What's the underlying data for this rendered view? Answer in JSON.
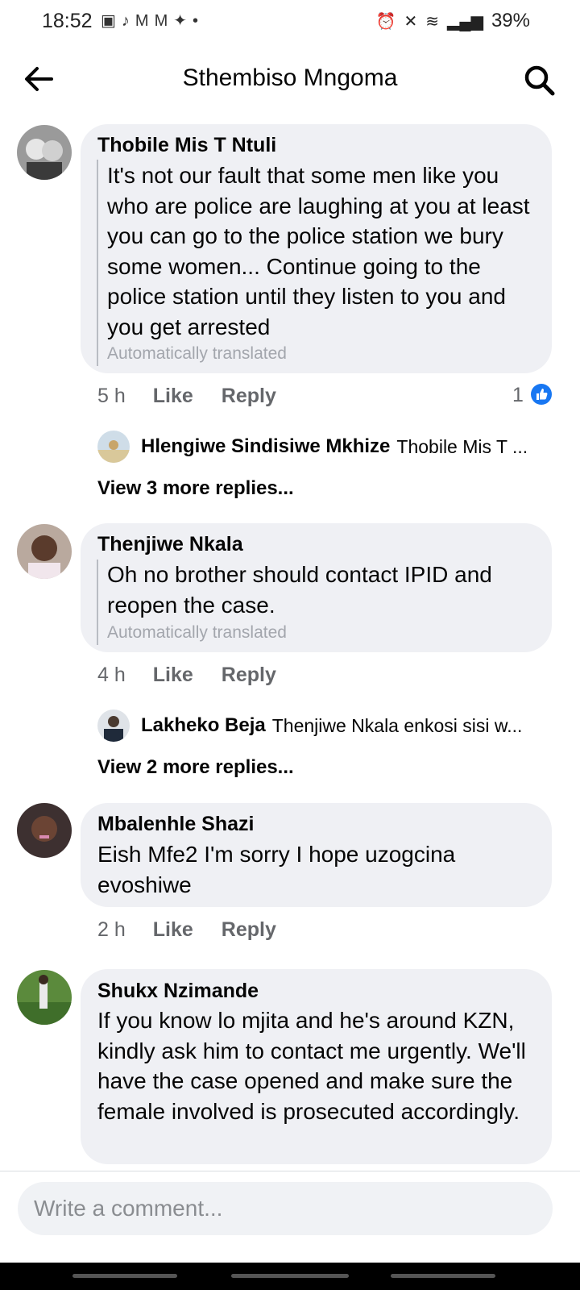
{
  "status_bar": {
    "time": "18:52",
    "battery": "39%",
    "left_icons": [
      "teams-icon",
      "tiktok-icon",
      "gmail-icon",
      "gmail-icon",
      "twitter-icon",
      "dot-icon"
    ],
    "right_icons": [
      "alarm-icon",
      "mute-icon",
      "wifi-icon",
      "signal-icon",
      "battery-icon"
    ]
  },
  "header": {
    "title": "Sthembiso Mngoma",
    "back_icon": "back-arrow-icon",
    "search_icon": "search-icon"
  },
  "comments": [
    {
      "name": "Thobile Mis T Ntuli",
      "text": "It's not our fault that some men like you who are police are laughing at you at least you can go to the police station we bury some women... Continue going to the police station until they listen to you and you get arrested",
      "translated": "Automatically translated",
      "time": "5 h",
      "like": "Like",
      "reply": "Reply",
      "reactions": "1",
      "reply_preview": {
        "name": "Hlengiwe Sindisiwe Mkhize",
        "snippet": "Thobile Mis T ..."
      },
      "more_replies": "View 3 more replies..."
    },
    {
      "name": "Thenjiwe Nkala",
      "text": "Oh no brother should contact IPID and reopen the case.",
      "translated": "Automatically translated",
      "time": "4 h",
      "like": "Like",
      "reply": "Reply",
      "reply_preview": {
        "name": "Lakheko Beja",
        "snippet": "Thenjiwe Nkala enkosi sisi w..."
      },
      "more_replies": "View 2 more replies..."
    },
    {
      "name": "Mbalenhle Shazi",
      "text": "Eish Mfe2 I'm sorry I hope uzogcina evoshiwe",
      "time": "2 h",
      "like": "Like",
      "reply": "Reply"
    },
    {
      "name": "Shukx Nzimande",
      "text": "If you know lo mjita and he's around KZN, kindly ask him to contact me urgently. We'll have the case opened and make sure the female involved is prosecuted accordingly."
    }
  ],
  "composer": {
    "placeholder": "Write a comment..."
  },
  "colors": {
    "like_blue": "#1877f2",
    "bubble_bg": "#eff0f4",
    "meta_gray": "#65676b"
  }
}
